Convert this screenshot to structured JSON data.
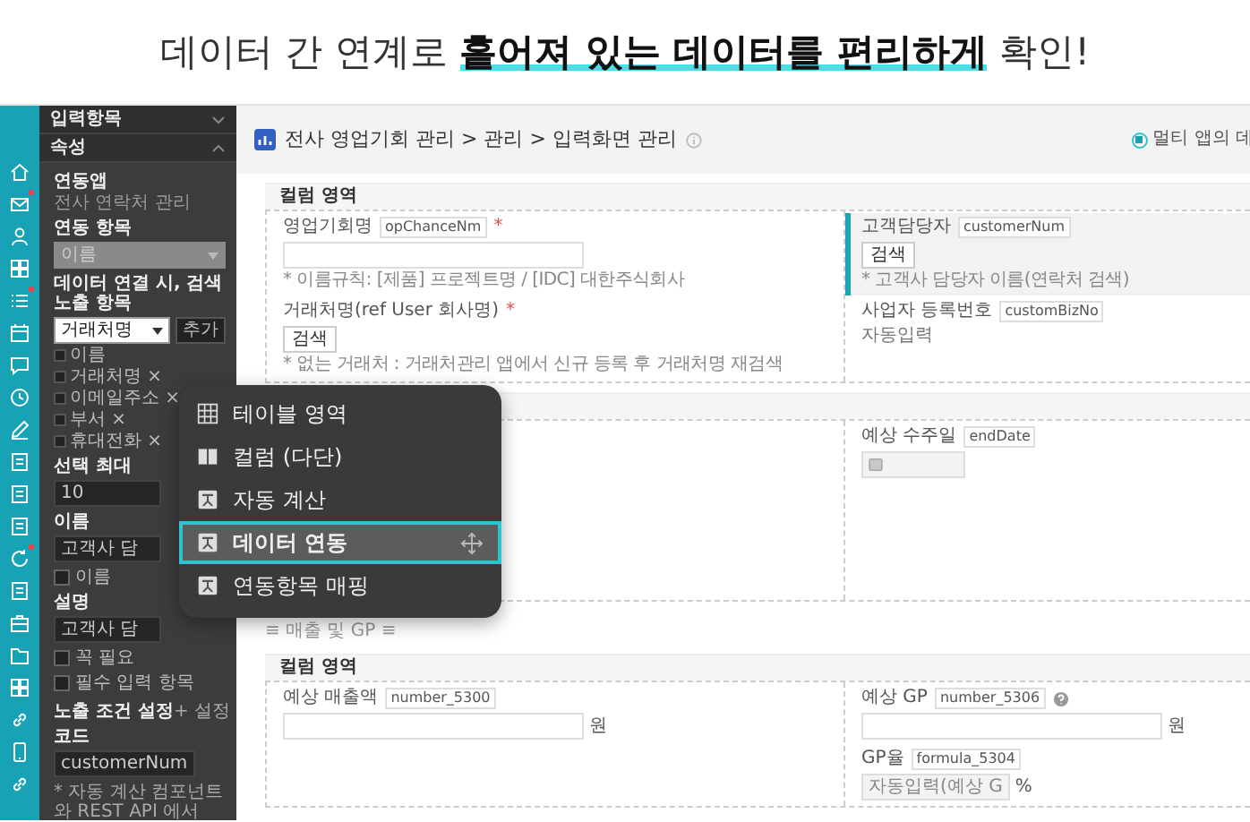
{
  "headline": "데이터 간 연계로 **흩어져 있는 데이터를 편리하게** 확인!",
  "rail": [
    {
      "badge": false
    },
    {
      "badge": true
    },
    {
      "badge": false
    },
    {
      "badge": false
    },
    {
      "badge": true
    },
    {
      "badge": false
    },
    {
      "badge": false
    },
    {
      "badge": false
    },
    {
      "badge": false
    },
    {
      "badge": false
    },
    {
      "badge": false
    },
    {
      "badge": false
    },
    {
      "badge": true
    },
    {
      "badge": false
    },
    {
      "badge": false
    },
    {
      "badge": false
    },
    {
      "badge": false
    },
    {
      "badge": false
    },
    {
      "badge": false
    },
    {
      "badge": false
    }
  ],
  "sidebar": {
    "blocks": [
      {
        "kind": "heading",
        "text": "입력항목",
        "expanded": false
      },
      {
        "kind": "heading",
        "text": "속성",
        "expanded": true
      },
      {
        "kind": "label",
        "text": "연동앱"
      },
      {
        "kind": "text",
        "text": "전사 연락처 관리"
      },
      {
        "kind": "label",
        "text": "연동 항목"
      },
      {
        "kind": "select",
        "text": "이름",
        "disabled": true
      },
      {
        "kind": "label",
        "text": "데이터 연결 시, 검색 노출 항목"
      },
      {
        "kind": "select",
        "text": "거래처명",
        "disabled": false,
        "button": "추가"
      },
      {
        "kind": "chip",
        "text": "이름"
      },
      {
        "kind": "chip",
        "text": "거래처명 ×"
      },
      {
        "kind": "chip",
        "text": "이메일주소 ×"
      },
      {
        "kind": "chip",
        "text": "부서 ×"
      },
      {
        "kind": "chip",
        "text": "휴대전화 ×"
      },
      {
        "kind": "label",
        "text": "선택 최대"
      },
      {
        "kind": "input",
        "text": "10"
      },
      {
        "kind": "label",
        "text": "이름"
      },
      {
        "kind": "input",
        "text": "고객사 담"
      },
      {
        "kind": "checkbox",
        "text": "이름",
        "checked": false
      },
      {
        "kind": "label",
        "text": "설명"
      },
      {
        "kind": "input",
        "text": "고객사 담"
      },
      {
        "kind": "checkbox",
        "text": "꼭 필요",
        "checked": false
      },
      {
        "kind": "checkbox",
        "text": "필수 입력 항목",
        "checked": false
      },
      {
        "kind": "setting",
        "text": "노출 조건 설정",
        "button": "+ 설정"
      },
      {
        "kind": "label",
        "text": "코드"
      },
      {
        "kind": "input",
        "text": "customerNum"
      },
      {
        "kind": "note",
        "text": "* 자동 계산 컴포넌트와 REST API 에서"
      }
    ]
  },
  "page_header": {
    "breadcrumb": "전사 영업기회 관리 > 관리 > 입력화면 관리",
    "option": {
      "label": "멀티 앱의 데",
      "selected": true
    }
  },
  "cards": [
    {
      "kind": "columns",
      "title": "컬럼 영역",
      "columns": {
        "left": [
          {
            "label": "영업기회명",
            "code": "opChanceNm",
            "required_mark": "*",
            "kind": "input",
            "hint": "* 이름규칙: [제품] 프로젝트명 / [IDC] 대한주식회사",
            "selected": false
          },
          {
            "label": "거래처명(ref User 회사명)",
            "required_mark": "*",
            "kind": "button",
            "control_text": "검색",
            "hint": "* 없는 거래처 : 거래처관리 앱에서 신규 등록 후 거래처명 재검색",
            "selected": false
          }
        ],
        "right": [
          {
            "label": "고객담당자",
            "code": "customerNum",
            "kind": "button",
            "control_text": "검색",
            "hint": "* 고객사 담당자 이름(연락처 검색)",
            "selected": true
          },
          {
            "label": "사업자 등록번호",
            "code": "customBizNo",
            "kind": "text",
            "control_text": "자동입력",
            "selected": false
          }
        ]
      }
    },
    {
      "kind": "columns",
      "columns": {
        "right": [
          {
            "label": "예상 수주일",
            "code": "endDate",
            "kind": "date",
            "selected": false
          }
        ]
      }
    },
    {
      "kind": "divider",
      "title": "≡ 매출 및 GP ≡"
    },
    {
      "kind": "columns",
      "title": "컬럼 영역",
      "columns": {
        "left": [
          {
            "label": "예상 매출액",
            "code": "number_5300",
            "kind": "input",
            "unit": "원",
            "selected": false
          }
        ],
        "right": [
          {
            "label": "예상 GP",
            "code": "number_5306",
            "help": true,
            "kind": "input",
            "unit": "원",
            "selected": false
          },
          {
            "label": "GP율",
            "code": "formula_5304",
            "kind": "readonly",
            "control_text": "자동입력(예상 G",
            "unit": "%",
            "selected": false
          }
        ]
      }
    }
  ],
  "popup": {
    "items": [
      {
        "kind": "table",
        "label": "테이블 영역",
        "selected": false
      },
      {
        "kind": "columns",
        "label": "컬럼 (다단)",
        "selected": false
      },
      {
        "kind": "calc",
        "label": "자동 계산",
        "selected": false
      },
      {
        "kind": "link",
        "label": "데이터 연동",
        "selected": true
      },
      {
        "kind": "mapping",
        "label": "연동항목 매핑",
        "selected": false
      }
    ]
  }
}
